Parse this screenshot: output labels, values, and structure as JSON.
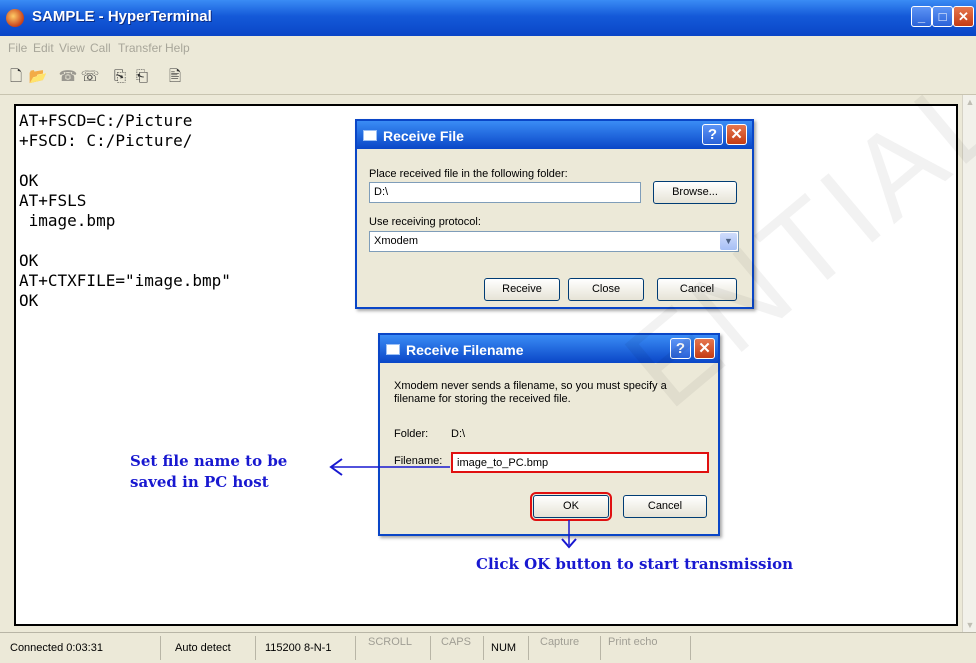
{
  "window": {
    "title": "SAMPLE - HyperTerminal",
    "controls": {
      "minimize": "_",
      "maximize": "□",
      "close": "✕"
    }
  },
  "menu": [
    "File",
    "Edit",
    "View",
    "Call",
    "Transfer",
    "Help"
  ],
  "toolbar": [
    {
      "icon": "new-icon",
      "glyph": "🗋"
    },
    {
      "icon": "open-icon",
      "glyph": "📂"
    },
    {
      "icon": "dial-icon",
      "glyph": "☎"
    },
    {
      "icon": "disconnect-icon",
      "glyph": "☏"
    },
    {
      "icon": "send-icon",
      "glyph": "⎘"
    },
    {
      "icon": "receive-icon",
      "glyph": "⎗"
    },
    {
      "icon": "properties-icon",
      "glyph": "🖹"
    }
  ],
  "terminal": {
    "lines": "AT+FSCD=C:/Picture\n+FSCD: C:/Picture/\n\nOK\nAT+FSLS\n image.bmp\n\nOK\nAT+CTXFILE=\"image.bmp\"\nOK"
  },
  "receive_file": {
    "title": "Receive File",
    "help": "?",
    "close": "✕",
    "folder_label": "Place received file in the following folder:",
    "folder_value": "D:\\",
    "browse": "Browse...",
    "protocol_label": "Use receiving protocol:",
    "protocol_value": "Xmodem",
    "receive": "Receive",
    "close_btn": "Close",
    "cancel": "Cancel"
  },
  "receive_filename": {
    "title": "Receive Filename",
    "help": "?",
    "close": "✕",
    "message": "Xmodem never sends a filename, so you must specify a filename for storing the received file.",
    "folder_label": "Folder:",
    "folder_value": "D:\\",
    "filename_label": "Filename:",
    "filename_value": "image_to_PC.bmp",
    "ok": "OK",
    "cancel": "Cancel"
  },
  "annotations": {
    "set_name_line1": "Set file name to be",
    "set_name_line2": "saved in PC host",
    "click_ok": "Click OK button to start transmission"
  },
  "statusbar": {
    "connected": "Connected 0:03:31",
    "detect": "Auto detect",
    "settings": "115200 8-N-1",
    "scroll": "SCROLL",
    "caps": "CAPS",
    "num": "NUM",
    "capture": "Capture",
    "print_echo": "Print echo"
  },
  "watermark": "ENTIAL",
  "colors": {
    "annotation": "#1818d0",
    "highlight": "#e01010",
    "title_bar": "#0a46c7"
  }
}
